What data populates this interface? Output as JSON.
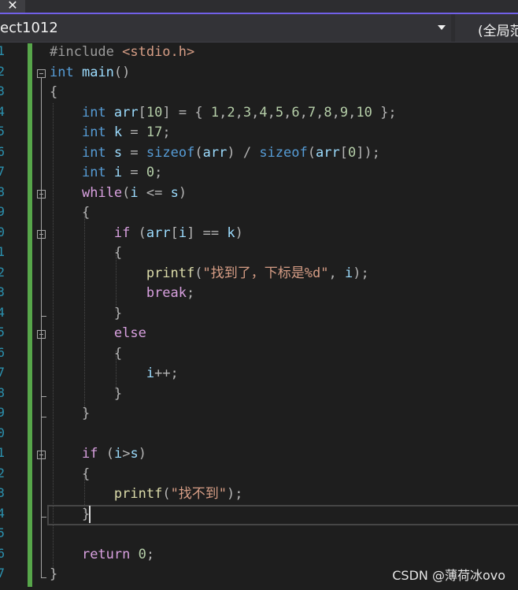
{
  "tabstrip": {
    "close_glyph": "✕"
  },
  "navbar": {
    "project_label": "ect1012",
    "scope_label": "(全局范"
  },
  "editor": {
    "line_numbers": [
      "1",
      "2",
      "3",
      "4",
      "5",
      "6",
      "7",
      "8",
      "9",
      "0",
      "1",
      "2",
      "3",
      "4",
      "5",
      "6",
      "7",
      "8",
      "9",
      "0",
      "1",
      "2",
      "3",
      "4",
      "5",
      "6",
      "7"
    ],
    "lines": [
      "#include <stdio.h>",
      "int main()",
      "{",
      "    int arr[10] = { 1,2,3,4,5,6,7,8,9,10 };",
      "    int k = 17;",
      "    int s = sizeof(arr) / sizeof(arr[0]);",
      "    int i = 0;",
      "    while(i <= s)",
      "    {",
      "        if (arr[i] == k)",
      "        {",
      "            printf(\"找到了，下标是%d\", i);",
      "            break;",
      "        }",
      "        else",
      "        {",
      "            i++;",
      "        }",
      "    }",
      "",
      "    if (i>s)",
      "    {",
      "        printf(\"找不到\");",
      "    }",
      "",
      "    return 0;",
      "}"
    ]
  },
  "colors": {
    "background": "#1e1e1e",
    "keyword": "#569cd6",
    "control": "#d8a0df",
    "string": "#d69d85",
    "number": "#b5cea8",
    "line_number": "#2b91af",
    "change_bar": "#57a64a",
    "tab_accent": "#7160e8"
  },
  "watermark": "CSDN @薄荷冰ovo"
}
